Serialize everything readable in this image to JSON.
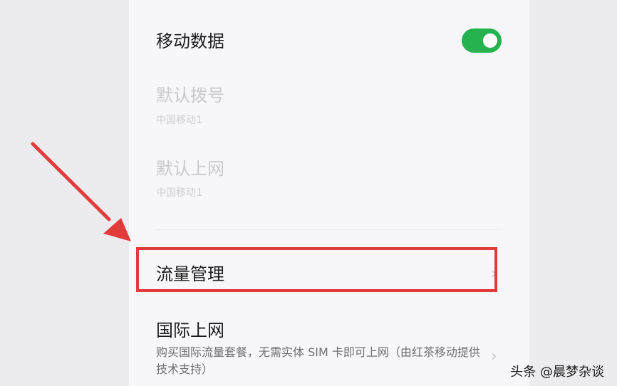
{
  "settings": {
    "mobile_data": {
      "label": "移动数据",
      "enabled": true
    },
    "default_dial": {
      "label": "默认拨号",
      "value": "中国移动1"
    },
    "default_internet": {
      "label": "默认上网",
      "value": "中国移动1"
    },
    "data_management": {
      "label": "流量管理",
      "chevron": "›"
    },
    "international": {
      "label": "国际上网",
      "description": "购买国际流量套餐，无需实体 SIM 卡即可上网（由红茶移动提供技术支持）",
      "chevron": "›"
    }
  },
  "annotation": {
    "arrow_color": "#e23b3b",
    "box_color": "#e23b3b"
  },
  "colors": {
    "toggle_on": "#26b24f",
    "panel_bg": "#f7f7f9",
    "outer_bg": "#ececee"
  },
  "watermark": "头条 @晨梦杂谈"
}
